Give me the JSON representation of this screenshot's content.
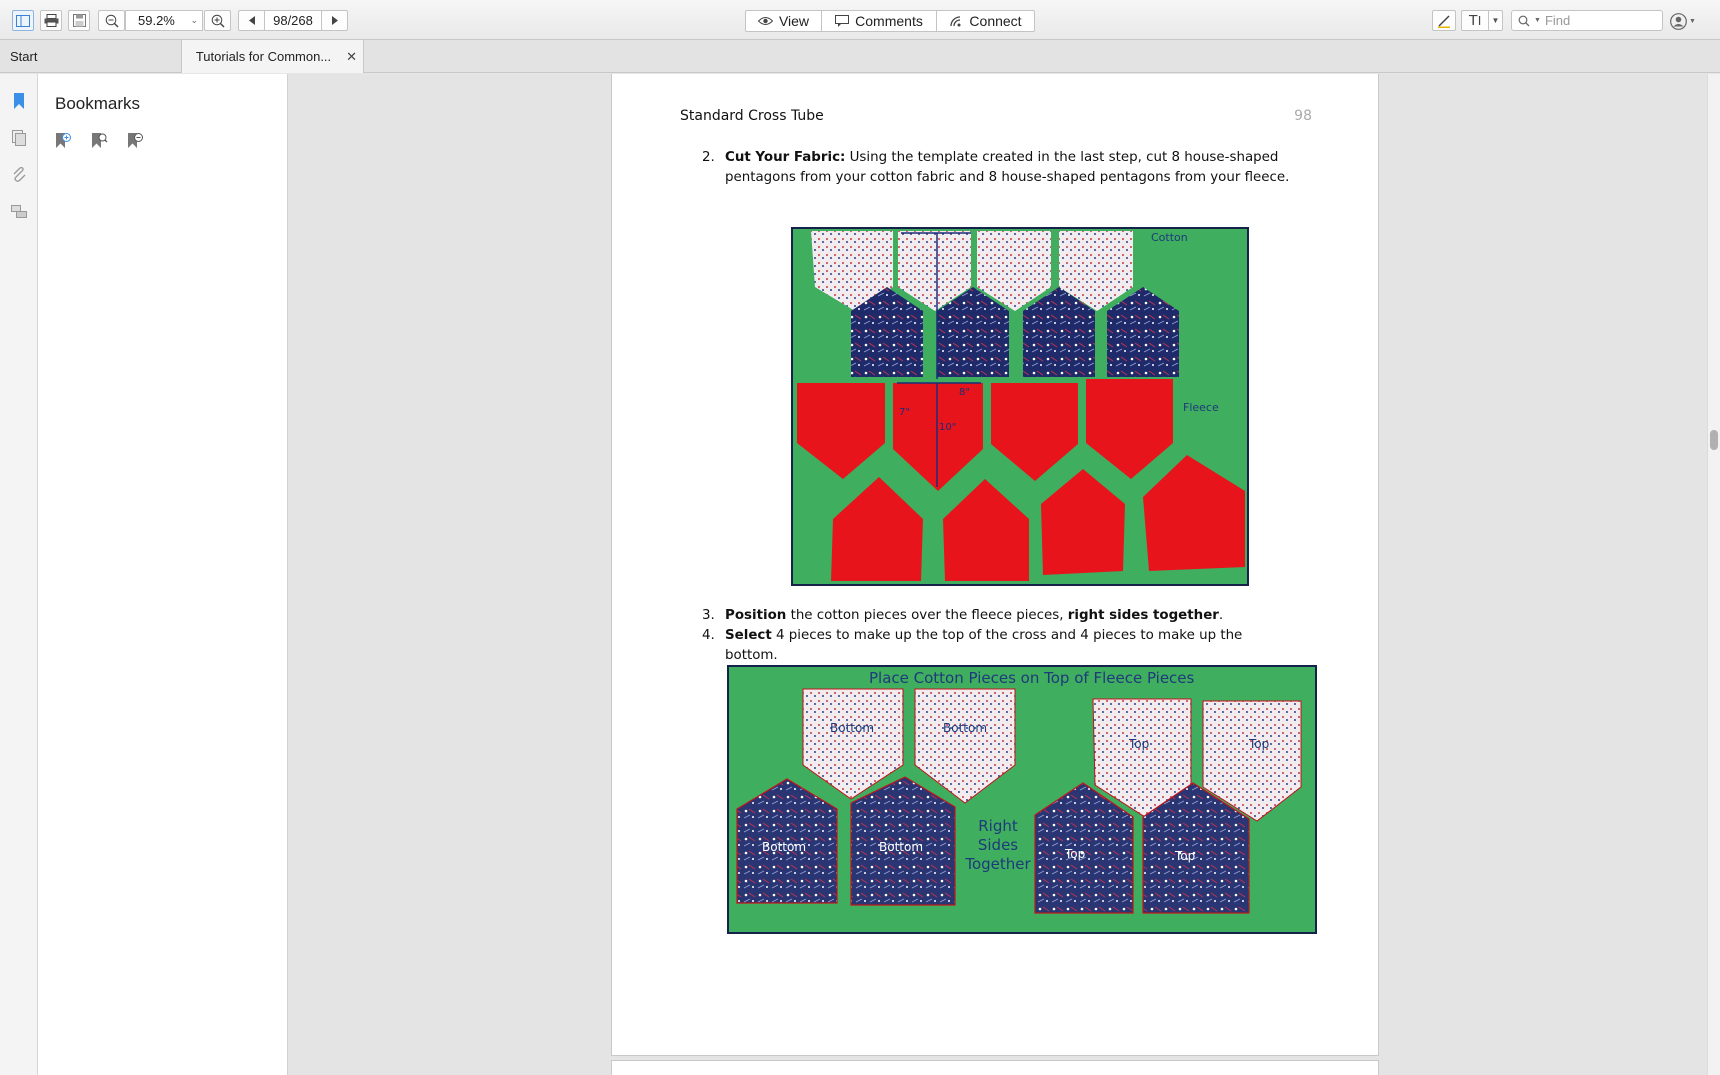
{
  "toolbar": {
    "zoom_value": "59.2%",
    "page_value": "98/268",
    "view_label": "View",
    "comments_label": "Comments",
    "connect_label": "Connect",
    "find_placeholder": "Find"
  },
  "tabs": [
    {
      "label": "Start",
      "active": false
    },
    {
      "label": "Tutorials for Common...",
      "active": true
    }
  ],
  "sidebar": {
    "title": "Bookmarks"
  },
  "document": {
    "running_head": "Standard Cross Tube",
    "page_number": "98",
    "step2": {
      "number": "2.",
      "bold": "Cut Your Fabric:",
      "text": " Using the template created in the last step, cut 8 house-shaped pentagons from your cotton fabric and 8 house-shaped pentagons from your fleece."
    },
    "figure1": {
      "cotton_label": "Cotton",
      "fleece_label": "Fleece",
      "dim_8": "8\"",
      "dim_10": "10\"",
      "dim_7": "7\""
    },
    "step3": {
      "number": "3.",
      "bold1": "Position",
      "text1": " the cotton pieces over the fleece pieces, ",
      "bold2": "right sides together",
      "text2": "."
    },
    "step4": {
      "number": "4.",
      "bold": "Select",
      "text": " 4 pieces to make up the top of the cross and 4 pieces to make up the bottom."
    },
    "figure2": {
      "title": "Place Cotton Pieces on Top of Fleece Pieces",
      "bottom": "Bottom",
      "top": "Top",
      "rst_line1": "Right",
      "rst_line2": "Sides",
      "rst_line3": "Together"
    }
  }
}
